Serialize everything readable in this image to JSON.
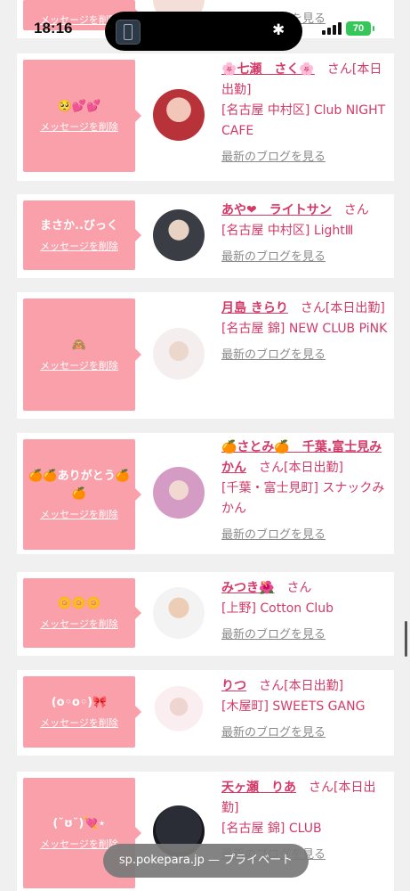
{
  "status_bar": {
    "time": "18:16",
    "battery": "70"
  },
  "colors": {
    "bubble": "#f9a0aa",
    "accent": "#d33a68",
    "muted_link": "#8b8b8b",
    "battery": "#35c759"
  },
  "top_partial": {
    "delete_label": "メッセージを削除",
    "blog_link": "最新のブログを見る"
  },
  "cards": [
    {
      "message": "🥺💕💕",
      "delete_label": "メッセージを削除",
      "name": "🌸七瀬　さく🌸",
      "san": "さん[本日出勤]",
      "shop": "[名古屋 中村区] Club NIGHT CAFE",
      "blog": "最新のブログを見る"
    },
    {
      "message": "まさか..びっく",
      "delete_label": "メッセージを削除",
      "name": "あや❤︎　ライトサン",
      "san": "さん",
      "shop": "[名古屋 中村区] LightⅢ",
      "blog": "最新のブログを見る"
    },
    {
      "message": "🙈",
      "delete_label": "メッセージを削除",
      "name": "月島 きらり",
      "san": "さん[本日出勤]",
      "shop": "[名古屋 錦] NEW CLUB PiNK",
      "blog": "最新のブログを見る"
    },
    {
      "message": "🍊🍊ありがとう🍊🍊",
      "delete_label": "メッセージを削除",
      "name": "🍊さとみ🍊　千葉.富士見みかん",
      "san": "さん[本日出勤]",
      "shop": "[千葉・富士見町] スナックみかん",
      "blog": "最新のブログを見る"
    },
    {
      "message": "🌼🌼🌼",
      "delete_label": "メッセージを削除",
      "name": "みつき🌺",
      "san": "さん",
      "shop": "[上野] Cotton Club",
      "blog": "最新のブログを見る"
    },
    {
      "message": "(o◦o◦)🎀",
      "delete_label": "メッセージを削除",
      "name": "りつ",
      "san": "さん[本日出勤]",
      "shop": "[木屋町] SWEETS GANG",
      "blog": "最新のブログを見る"
    },
    {
      "message": "(˘ʊ˘)💘⋆",
      "delete_label": "メッセージを削除",
      "name": "天ヶ瀬　りあ",
      "san": "さん[本日出勤]",
      "shop": "[名古屋 錦] CLUB",
      "blog": "最新のブログを見る"
    }
  ],
  "url_bar": {
    "text": "sp.pokepara.jp — プライベート"
  }
}
